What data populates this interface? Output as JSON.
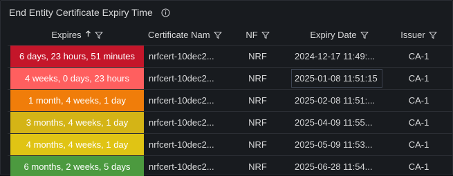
{
  "panel": {
    "title": "End Entity Certificate Expiry Time"
  },
  "columns": {
    "expires": "Expires",
    "certificate": "Certificate Nam",
    "nf": "NF",
    "expiry_date": "Expiry Date",
    "issuer": "Issuer"
  },
  "icons": {
    "sort": "sort-ascending-icon",
    "filter": "filter-icon",
    "info": "info-icon"
  },
  "rows": [
    {
      "expires": "6 days, 23 hours, 51 minutes",
      "color": "#c4162a",
      "certificate": "nrfcert-10dec2...",
      "nf": "NRF",
      "expiry_date": "2024-12-17 11:49:...",
      "issuer": "CA-1"
    },
    {
      "expires": "4 weeks, 0 days, 23 hours",
      "color": "#ff5f5f",
      "certificate": "nrfcert-10dec2...",
      "nf": "NRF",
      "expiry_date": "2025-01-08 11:51:15",
      "issuer": "CA-1"
    },
    {
      "expires": "1 month, 4 weeks, 1 day",
      "color": "#f07d0a",
      "certificate": "nrfcert-10dec2...",
      "nf": "NRF",
      "expiry_date": "2025-02-08 11:51:...",
      "issuer": "CA-1"
    },
    {
      "expires": "3 months, 4 weeks, 1 day",
      "color": "#d4b416",
      "certificate": "nrfcert-10dec2...",
      "nf": "NRF",
      "expiry_date": "2025-04-09 11:55...",
      "issuer": "CA-1"
    },
    {
      "expires": "4 months, 4 weeks, 1 day",
      "color": "#e0c414",
      "certificate": "nrfcert-10dec2...",
      "nf": "NRF",
      "expiry_date": "2025-05-09 11:53...",
      "issuer": "CA-1"
    },
    {
      "expires": "6 months, 2 weeks, 5 days",
      "color": "#4c9a3f",
      "certificate": "nrfcert-10dec2...",
      "nf": "NRF",
      "expiry_date": "2025-06-28 11:54...",
      "issuer": "CA-1"
    }
  ]
}
